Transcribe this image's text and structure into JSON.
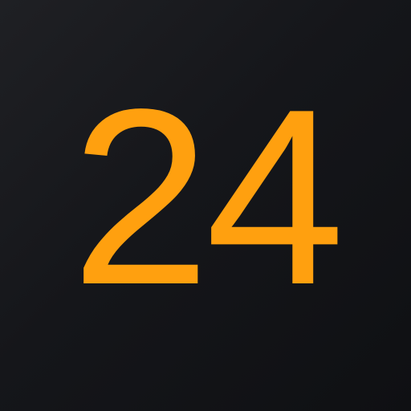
{
  "icon": {
    "label": "24",
    "text_color": "#FFA00F",
    "background_color": "#16171B"
  }
}
